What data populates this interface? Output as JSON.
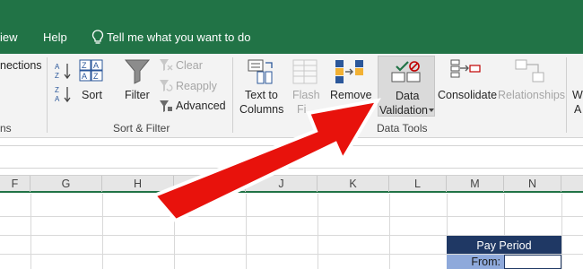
{
  "menu": {
    "view": "iew",
    "help": "Help",
    "tell_me": "Tell me what you want to do"
  },
  "ribbon": {
    "connections": "nections",
    "sort": "Sort",
    "filter": "Filter",
    "clear": "Clear",
    "reapply": "Reapply",
    "advanced": "Advanced",
    "text_to_columns_1": "Text to",
    "text_to_columns_2": "Columns",
    "flash_fill_1": "Flash",
    "flash_fill_2": "Fi",
    "remove_duplicates": "Remove",
    "data_validation_1": "Data",
    "data_validation_2": "Validation",
    "consolidate": "Consolidate",
    "relationships": "Relationships",
    "whatif_1": "W",
    "whatif_2": "A",
    "groups": {
      "connections": "ns",
      "sort_filter": "Sort & Filter",
      "data_tools": "Data Tools"
    }
  },
  "columns": [
    "F",
    "G",
    "H",
    "",
    "J",
    "K",
    "L",
    "M",
    "N"
  ],
  "sheet": {
    "pay_period": "Pay Period",
    "from": "From:"
  },
  "colors": {
    "excel_green": "#217346",
    "ribbon_bg": "#f3f3f3",
    "arrow_red": "#e8120c",
    "header_navy": "#1f3864",
    "label_blue": "#8ea9db"
  }
}
